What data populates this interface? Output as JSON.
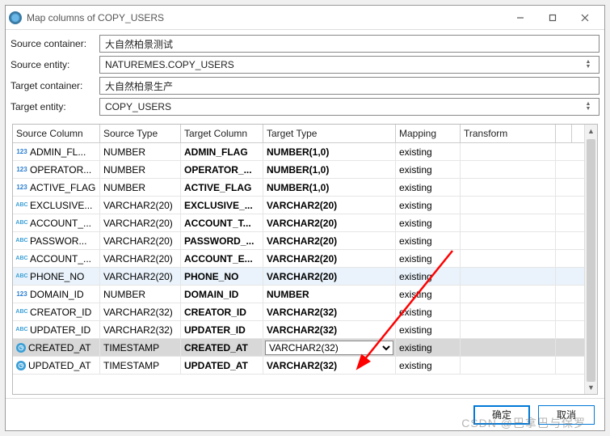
{
  "window": {
    "title": "Map columns of COPY_USERS"
  },
  "form": {
    "source_container_label": "Source container:",
    "source_container": "大自然柏景测试",
    "source_entity_label": "Source entity:",
    "source_entity": "NATUREMES.COPY_USERS",
    "target_container_label": "Target container:",
    "target_container": "大自然柏景生产",
    "target_entity_label": "Target entity:",
    "target_entity": "COPY_USERS"
  },
  "columns": {
    "h0": "Source Column",
    "h1": "Source Type",
    "h2": "Target Column",
    "h3": "Target Type",
    "h4": "Mapping",
    "h5": "Transform"
  },
  "rows": [
    {
      "icon": "num",
      "sc": "ADMIN_FL...",
      "st": "NUMBER",
      "tc": "ADMIN_FLAG",
      "tt": "NUMBER(1,0)",
      "map": "existing",
      "tr": ""
    },
    {
      "icon": "num",
      "sc": "OPERATOR...",
      "st": "NUMBER",
      "tc": "OPERATOR_...",
      "tt": "NUMBER(1,0)",
      "map": "existing",
      "tr": ""
    },
    {
      "icon": "num",
      "sc": "ACTIVE_FLAG",
      "st": "NUMBER",
      "tc": "ACTIVE_FLAG",
      "tt": "NUMBER(1,0)",
      "map": "existing",
      "tr": ""
    },
    {
      "icon": "abc",
      "sc": "EXCLUSIVE...",
      "st": "VARCHAR2(20)",
      "tc": "EXCLUSIVE_...",
      "tt": "VARCHAR2(20)",
      "map": "existing",
      "tr": ""
    },
    {
      "icon": "abc",
      "sc": "ACCOUNT_...",
      "st": "VARCHAR2(20)",
      "tc": "ACCOUNT_T...",
      "tt": "VARCHAR2(20)",
      "map": "existing",
      "tr": ""
    },
    {
      "icon": "abc",
      "sc": "PASSWOR...",
      "st": "VARCHAR2(20)",
      "tc": "PASSWORD_...",
      "tt": "VARCHAR2(20)",
      "map": "existing",
      "tr": ""
    },
    {
      "icon": "abc",
      "sc": "ACCOUNT_...",
      "st": "VARCHAR2(20)",
      "tc": "ACCOUNT_E...",
      "tt": "VARCHAR2(20)",
      "map": "existing",
      "tr": ""
    },
    {
      "icon": "abc",
      "sc": "PHONE_NO",
      "st": "VARCHAR2(20)",
      "tc": "PHONE_NO",
      "tt": "VARCHAR2(20)",
      "map": "existing",
      "tr": "",
      "hover": true
    },
    {
      "icon": "num",
      "sc": "DOMAIN_ID",
      "st": "NUMBER",
      "tc": "DOMAIN_ID",
      "tt": "NUMBER",
      "map": "existing",
      "tr": ""
    },
    {
      "icon": "abc",
      "sc": "CREATOR_ID",
      "st": "VARCHAR2(32)",
      "tc": "CREATOR_ID",
      "tt": "VARCHAR2(32)",
      "map": "existing",
      "tr": ""
    },
    {
      "icon": "abc",
      "sc": "UPDATER_ID",
      "st": "VARCHAR2(32)",
      "tc": "UPDATER_ID",
      "tt": "VARCHAR2(32)",
      "map": "existing",
      "tr": ""
    },
    {
      "icon": "ts",
      "sc": "CREATED_AT",
      "st": "TIMESTAMP",
      "tc": "CREATED_AT",
      "tt": "VARCHAR2(32)",
      "map": "existing",
      "tr": "",
      "selected": true
    },
    {
      "icon": "ts",
      "sc": "UPDATED_AT",
      "st": "TIMESTAMP",
      "tc": "UPDATED_AT",
      "tt": "VARCHAR2(32)",
      "map": "existing",
      "tr": ""
    }
  ],
  "footer": {
    "ok": "确定",
    "cancel": "取消"
  },
  "watermark": "CSDN @巴拿巴与保罗",
  "icon_labels": {
    "num": "123",
    "abc": "ABC",
    "ts": "◷"
  }
}
